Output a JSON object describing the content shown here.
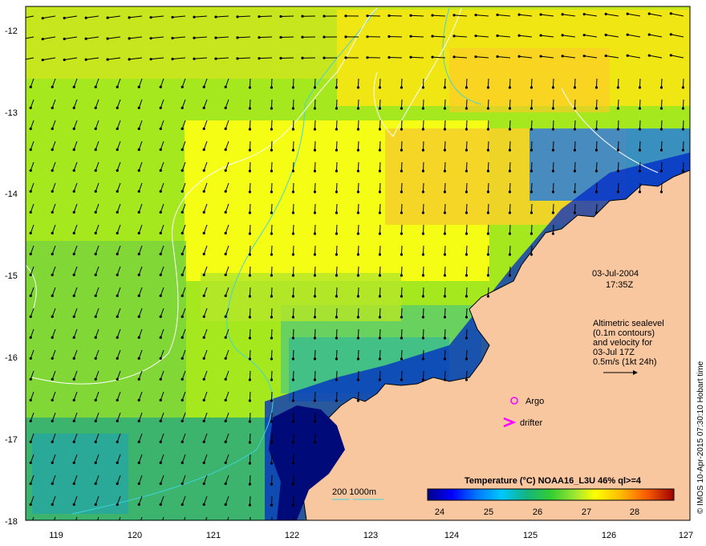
{
  "map": {
    "lat_ticks": [
      "-12",
      "-13",
      "-14",
      "-15",
      "-16",
      "-17",
      "-18"
    ],
    "lon_ticks": [
      "119",
      "120",
      "121",
      "122",
      "123",
      "124",
      "125",
      "126",
      "127"
    ]
  },
  "overlay": {
    "date": "03-Jul-2004",
    "time": "17:35Z",
    "altimetry": [
      "Altimetric sealevel",
      "(0.1m contours)",
      "and velocity for",
      "03-Jul 17Z",
      "0.5m/s (1kt 24h)"
    ],
    "argo_label": "Argo",
    "drifter_label": "drifter",
    "depth_legend": "200  1000m"
  },
  "colorbar": {
    "title": "Temperature (°C) NOAA16_L3U 46% ql>=4",
    "ticks": [
      "24",
      "25",
      "26",
      "27",
      "28"
    ]
  },
  "credit": "© IMOS 10-Apr-2015 07:30:10 Hobart time",
  "colors": {
    "land": "#f9c79f",
    "contour_200": "#3fd4dc",
    "contour_1000": "#ffffff",
    "argo": "#ff00ff",
    "drifter": "#ff00ff"
  }
}
